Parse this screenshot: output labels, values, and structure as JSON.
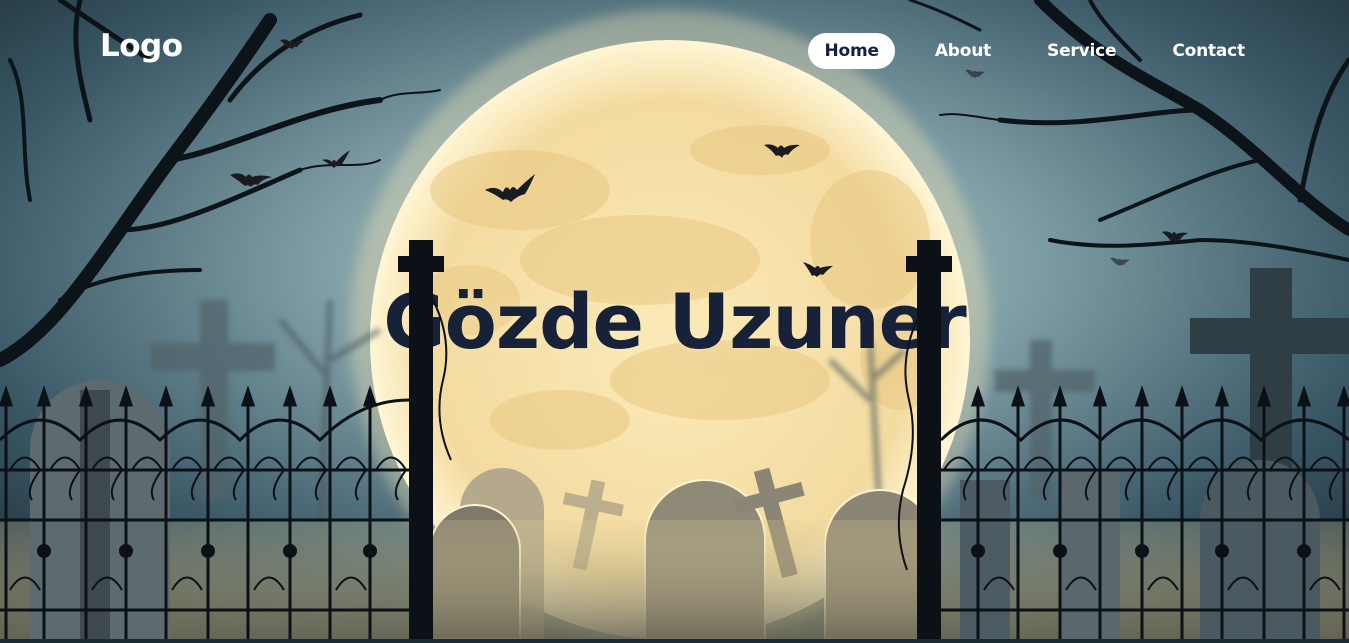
{
  "header": {
    "logo": "Logo",
    "nav": [
      {
        "label": "Home",
        "active": true
      },
      {
        "label": "About",
        "active": false
      },
      {
        "label": "Service",
        "active": false
      },
      {
        "label": "Contact",
        "active": false
      }
    ]
  },
  "hero": {
    "title": "Gözde Uzuner"
  },
  "colors": {
    "sky_dark": "#1c2c36",
    "sky_mid": "#5e7f8c",
    "moon": "#f3dfa4",
    "title_text": "#172238",
    "nav_active_bg": "#ffffff",
    "silhouette": "#0d1419"
  },
  "icons": {
    "bat": "bat-icon",
    "cross": "grave-cross-icon"
  }
}
